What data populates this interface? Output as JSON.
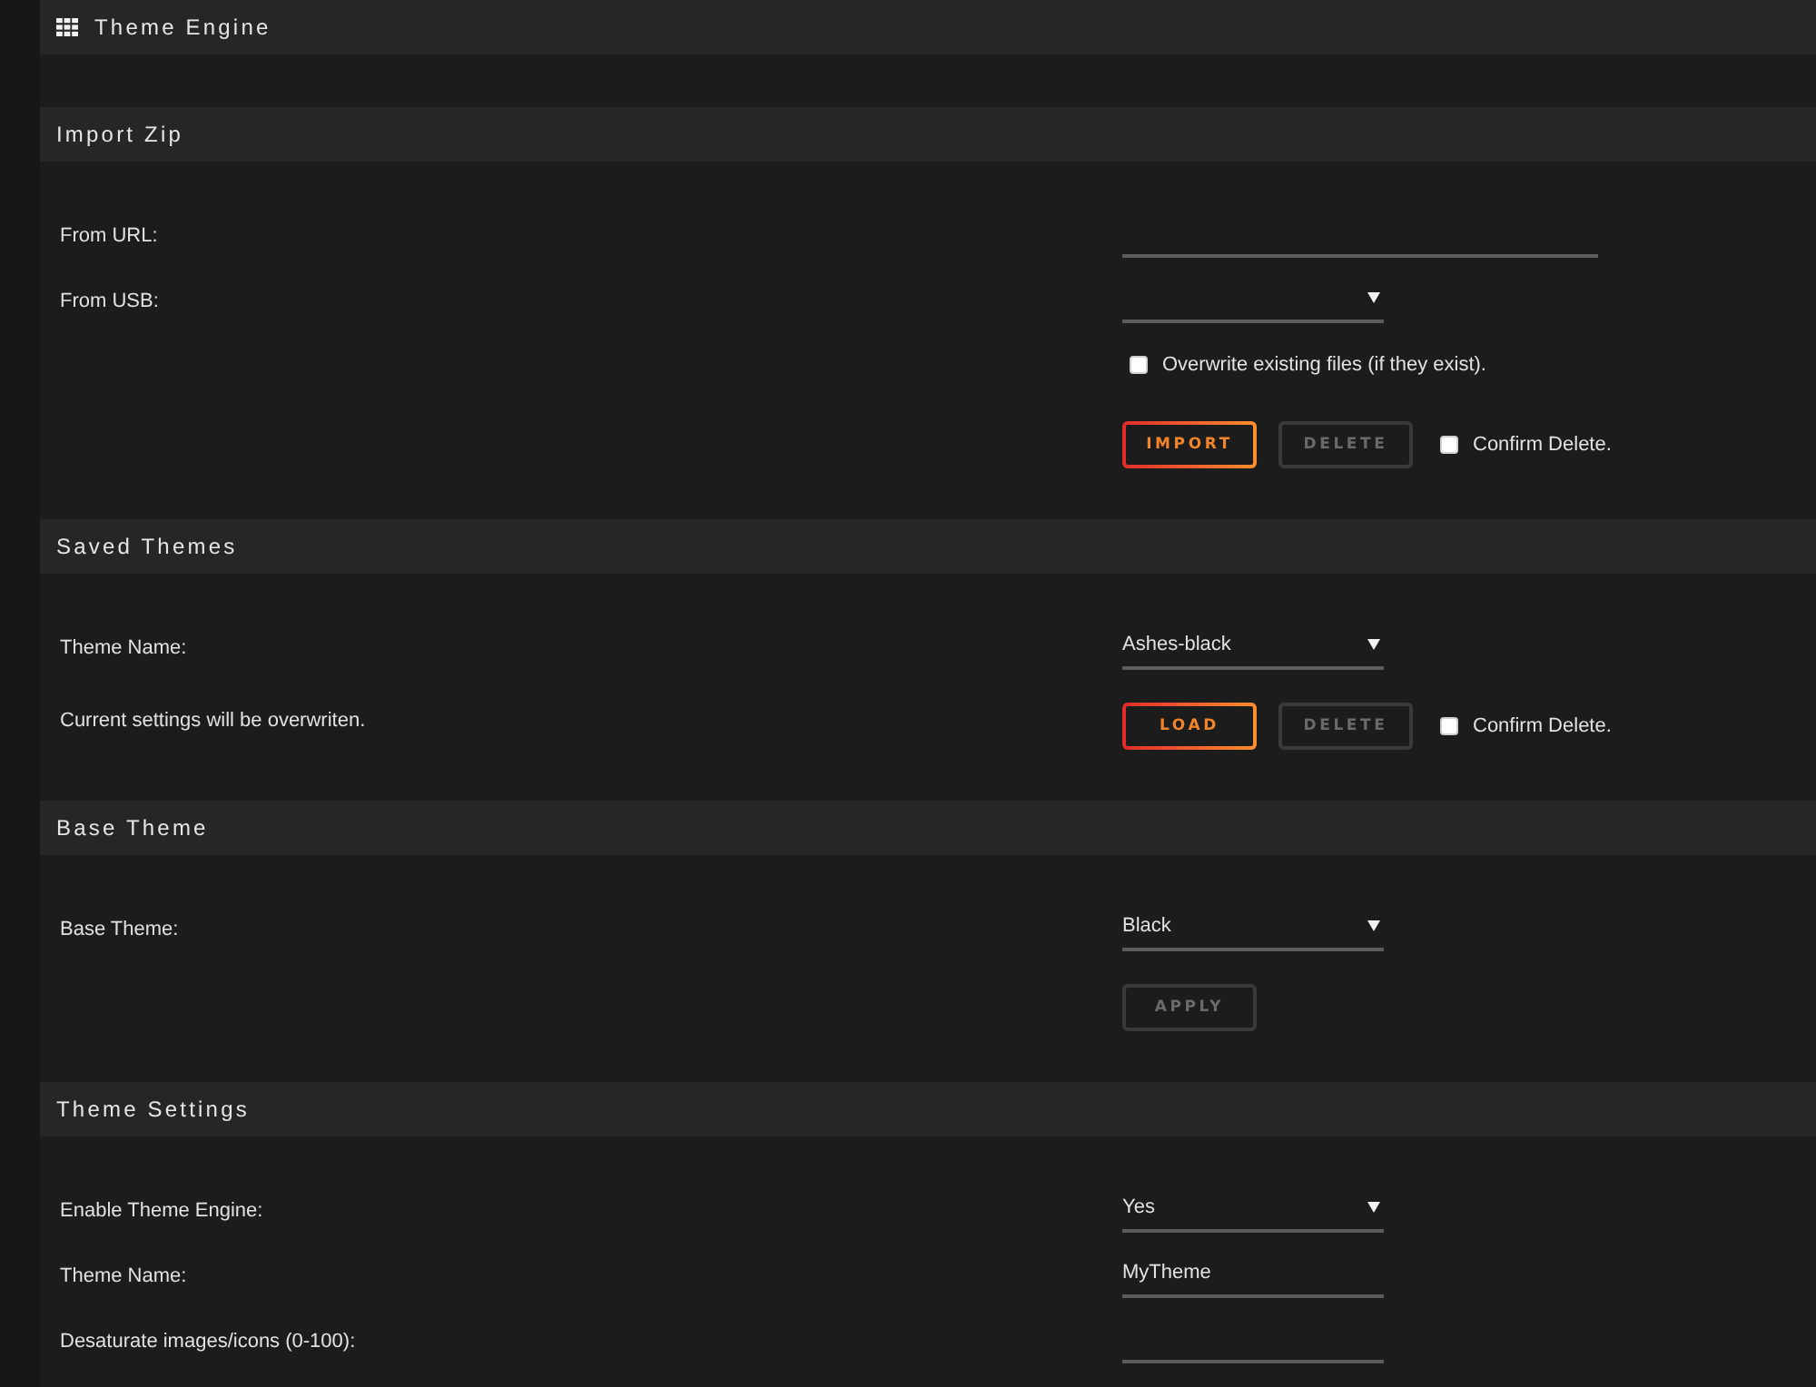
{
  "header": {
    "title": "Theme Engine"
  },
  "sections": [
    {
      "title": "Import Zip",
      "rows": [
        {
          "kind": "wide-input",
          "label": "From URL:"
        },
        {
          "kind": "select",
          "label": "From USB:"
        },
        {
          "kind": "checkbox",
          "text": "Overwrite existing files (if they exist).",
          "checked": false
        },
        {
          "kind": "actions",
          "buttons": [
            {
              "label": "IMPORT",
              "disabled": false
            },
            {
              "label": "DELETE",
              "disabled": true
            }
          ],
          "confirm": {
            "text": "Confirm Delete.",
            "checked": false
          }
        }
      ]
    },
    {
      "title": "Saved Themes",
      "rows": [
        {
          "kind": "select",
          "label": "Theme Name:",
          "value": "Ashes-black"
        },
        {
          "kind": "actions",
          "label": "Current settings will be overwriten.",
          "buttons": [
            {
              "label": "LOAD",
              "disabled": false
            },
            {
              "label": "DELETE",
              "disabled": true
            }
          ],
          "confirm": {
            "text": "Confirm Delete.",
            "checked": false
          }
        }
      ]
    },
    {
      "title": "Base Theme",
      "rows": [
        {
          "kind": "select",
          "label": "Base Theme:",
          "value": "Black"
        },
        {
          "kind": "actions",
          "buttons": [
            {
              "label": "APPLY",
              "disabled": true
            }
          ]
        }
      ]
    },
    {
      "title": "Theme Settings",
      "rows": [
        {
          "kind": "select",
          "label": "Enable Theme Engine:",
          "value": "Yes"
        },
        {
          "kind": "input",
          "label": "Theme Name:",
          "value": "MyTheme"
        },
        {
          "kind": "input",
          "label": "Desaturate images/icons (0-100):"
        }
      ]
    }
  ]
}
